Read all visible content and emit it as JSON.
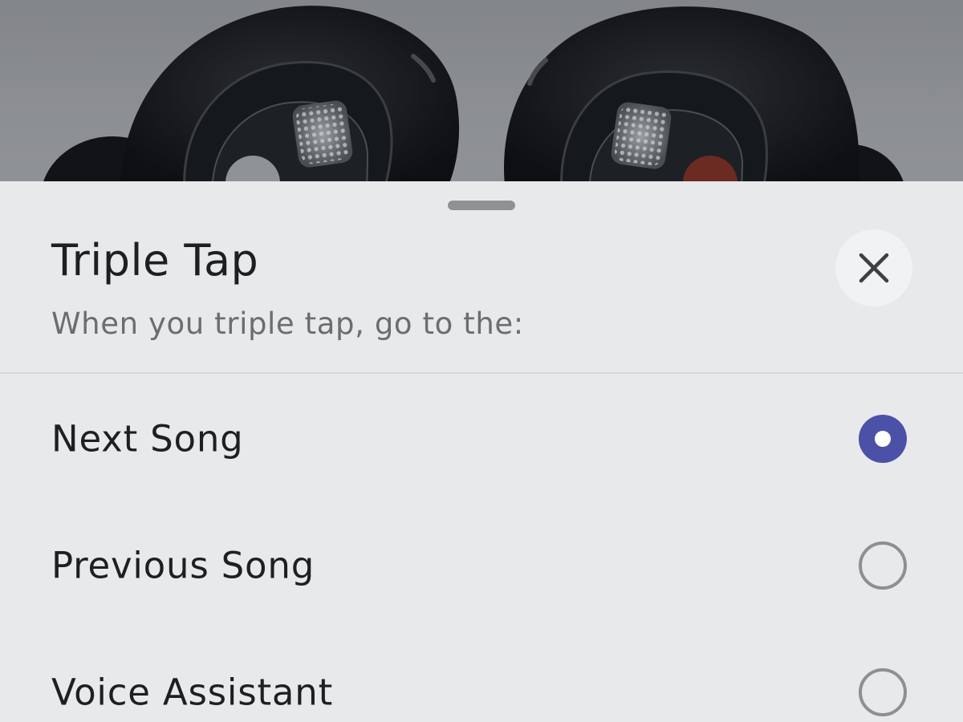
{
  "hero": {
    "image": "earbuds-product-image"
  },
  "sheet": {
    "title": "Triple Tap",
    "subtitle": "When you triple tap, go to the:",
    "close_icon": "close-icon"
  },
  "options": [
    {
      "label": "Next Song",
      "selected": true
    },
    {
      "label": "Previous Song",
      "selected": false
    },
    {
      "label": "Voice Assistant",
      "selected": false
    }
  ],
  "colors": {
    "accent": "#4b51a6",
    "sheet_background": "#e8e9eb",
    "hero_background": "#8a8d91",
    "title_text": "#1e1f22",
    "subtitle_text": "#6b6d72",
    "radio_unselected": "#8e8f92"
  }
}
